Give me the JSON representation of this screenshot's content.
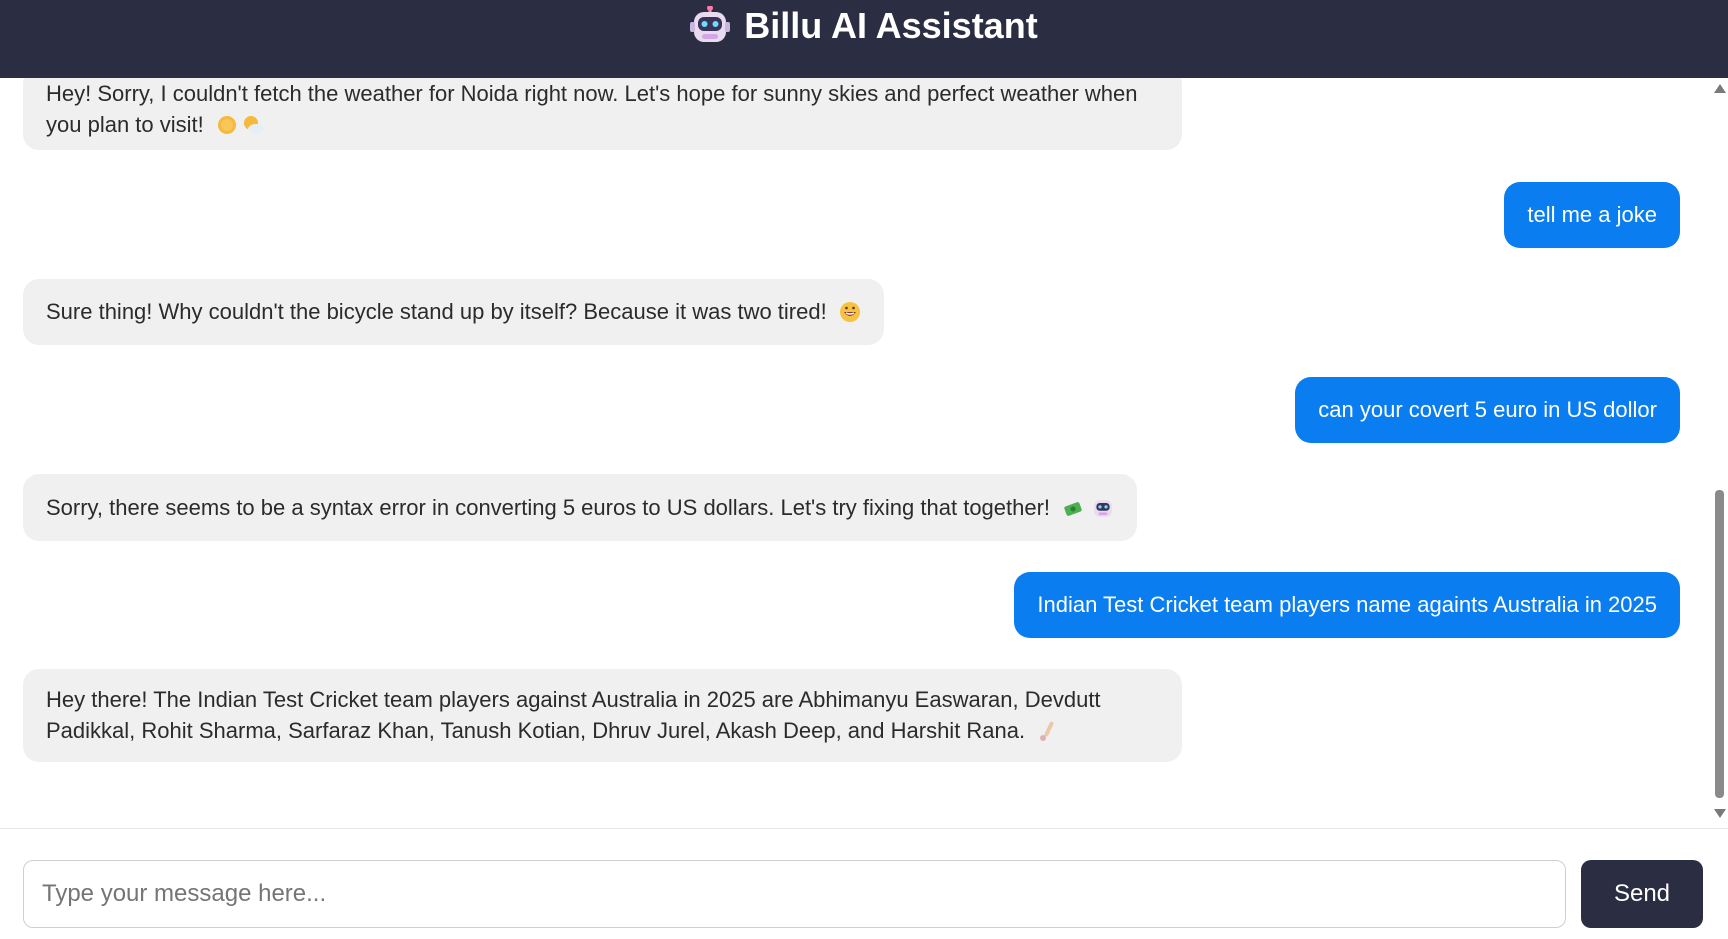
{
  "header": {
    "title": "Billu AI Assistant",
    "icon": "robot-icon"
  },
  "messages": [
    {
      "role": "bot",
      "text": "Hey! Sorry, I couldn't fetch the weather for Noida right now. Let's hope for sunny skies and perfect weather when you plan to visit!",
      "emojis": [
        "sun-icon",
        "sun-behind-cloud-icon"
      ]
    },
    {
      "role": "user",
      "text": "tell me a joke"
    },
    {
      "role": "bot",
      "text": "Sure thing! Why couldn't the bicycle stand up by itself? Because it was two tired!",
      "emojis": [
        "grinning-face-icon"
      ]
    },
    {
      "role": "user",
      "text": "can your covert 5 euro in US dollor"
    },
    {
      "role": "bot",
      "text": "Sorry, there seems to be a syntax error in converting 5 euros to US dollars. Let's try fixing that together!",
      "emojis": [
        "money-with-wings-icon",
        "robot-icon"
      ]
    },
    {
      "role": "user",
      "text": "Indian Test Cricket team players name againts Australia in 2025"
    },
    {
      "role": "bot",
      "text": "Hey there! The Indian Test Cricket team players against Australia in 2025 are Abhimanyu Easwaran, Devdutt Padikkal, Rohit Sharma, Sarfaraz Khan, Tanush Kotian, Dhruv Jurel, Akash Deep, and Harshit Rana.",
      "emojis": [
        "cricket-icon"
      ]
    }
  ],
  "composer": {
    "placeholder": "Type your message here...",
    "value": "",
    "send_label": "Send"
  },
  "colors": {
    "header_bg": "#2b2d42",
    "user_bubble": "#0a7df0",
    "bot_bubble": "#f0f0f0",
    "send_button": "#2b2d42"
  }
}
